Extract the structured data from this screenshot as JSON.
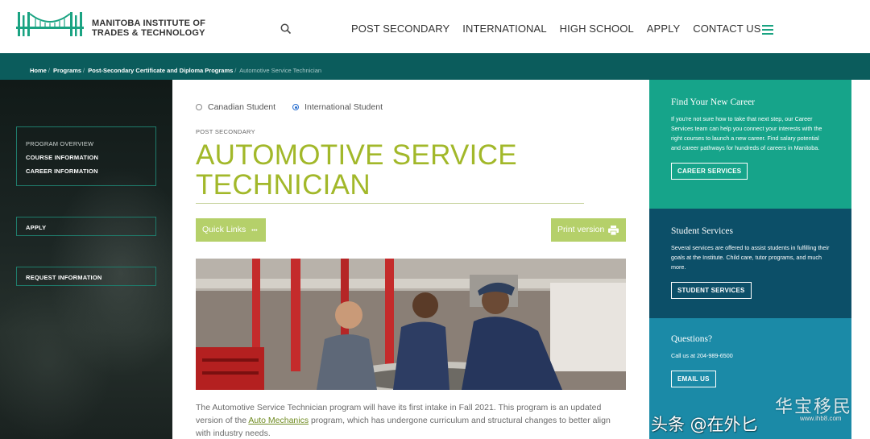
{
  "header": {
    "logo_line1": "MANITOBA INSTITUTE OF",
    "logo_line2": "TRADES & TECHNOLOGY",
    "nav": [
      "POST SECONDARY",
      "INTERNATIONAL",
      "HIGH SCHOOL",
      "APPLY",
      "CONTACT US"
    ],
    "accent": "#1aa382"
  },
  "breadcrumb": {
    "items": [
      "Home",
      "Programs",
      "Post-Secondary Certificate and Diploma Programs"
    ],
    "current": "Automotive Service Technician"
  },
  "sidebar": {
    "nav_items": [
      "PROGRAM OVERVIEW",
      "COURSE INFORMATION",
      "CAREER INFORMATION"
    ],
    "apply_label": "APPLY",
    "request_label": "REQUEST INFORMATION"
  },
  "main": {
    "radio_canadian": "Canadian Student",
    "radio_international": "International Student",
    "selected_radio": "International Student",
    "eyebrow": "POST SECONDARY",
    "title": "AUTOMOTIVE SERVICE TECHNICIAN",
    "quick_links": "Quick Links",
    "quick_links_dots": "•••",
    "print_version": "Print version",
    "body_part1": "The Automotive Service Technician program will have its first intake in Fall 2021. This program is an updated version of the ",
    "body_link": "Auto Mechanics",
    "body_part2": " program, which has undergone curriculum and structural changes to better align with industry needs.",
    "title_color": "#a2b82a",
    "button_color": "#b5d06a"
  },
  "right": {
    "card1": {
      "title": "Find Your New Career",
      "text": "If you're not sure how to take that next step, our Career Services team can help you connect your interests with the right courses to launch a new career. Find salary potential and career pathways for hundreds of careers in Manitoba.",
      "cta": "CAREER SERVICES",
      "color": "#16a48a"
    },
    "card2": {
      "title": "Student Services",
      "text": "Several services are offered to assist students in fulfilling their goals at the Institute. Child care, tutor programs, and much more.",
      "cta": "STUDENT SERVICES",
      "color": "#0c4f68"
    },
    "card3": {
      "title": "Questions?",
      "text": "Call us at 204-989-6500",
      "cta": "EMAIL US",
      "color": "#1b8aa7"
    }
  },
  "watermark": {
    "text1": "头条 @在外匕",
    "text2": "华宝移民",
    "text3": "www.ihb8.com"
  }
}
